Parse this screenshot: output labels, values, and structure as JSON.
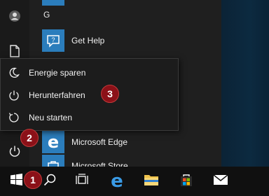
{
  "start_menu": {
    "letter_header": "G",
    "apps": [
      {
        "label": "Get Help",
        "icon": "help-bubble-icon"
      },
      {
        "label": "Microsoft Edge",
        "icon": "edge-icon"
      },
      {
        "label": "Microsoft Store",
        "icon": "store-icon"
      }
    ]
  },
  "power_menu": {
    "items": [
      {
        "label": "Energie sparen",
        "icon": "moon-icon"
      },
      {
        "label": "Herunterfahren",
        "icon": "power-icon"
      },
      {
        "label": "Neu starten",
        "icon": "restart-icon"
      }
    ]
  },
  "annotations": {
    "badge_1": "1",
    "badge_2": "2",
    "badge_3": "3"
  },
  "taskbar": {
    "items": [
      "start-icon",
      "search-icon",
      "task-view-icon",
      "edge-icon",
      "file-explorer-icon",
      "store-icon",
      "mail-icon"
    ]
  },
  "colors": {
    "accent_tile": "#2b7dbc",
    "badge": "#8b1118",
    "menu_bg": "#1f1f1f"
  }
}
